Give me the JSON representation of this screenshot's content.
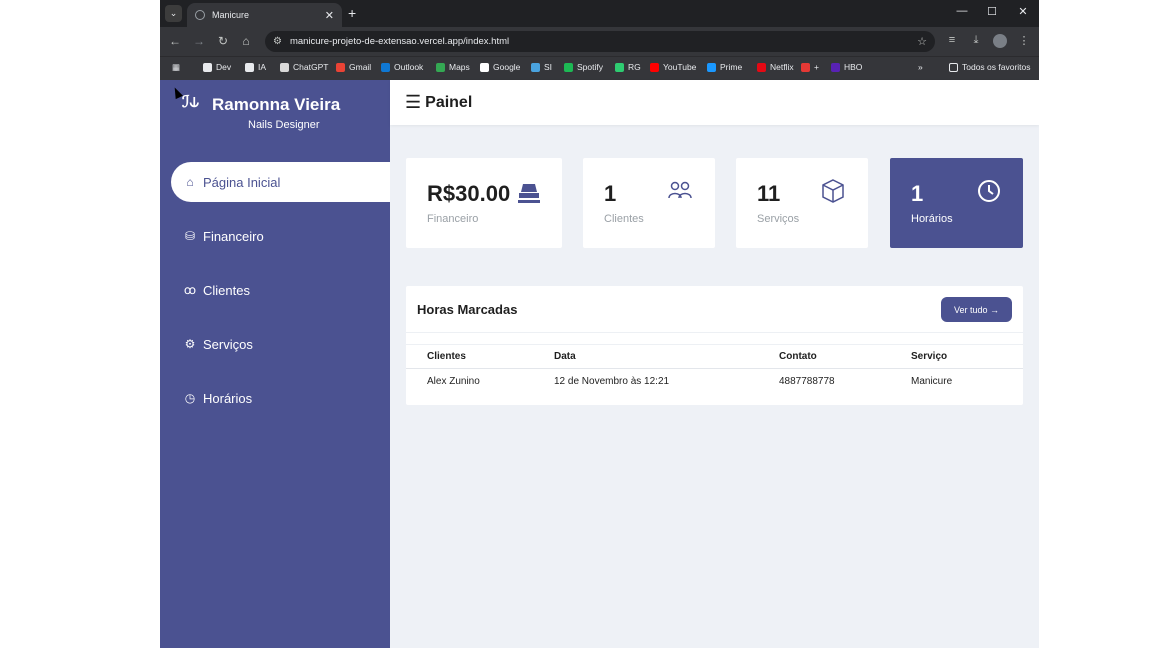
{
  "browser": {
    "tab_title": "Manicure",
    "url": "manicure-projeto-de-extensao.vercel.app/index.html",
    "bookmarks": [
      {
        "label": "Dev",
        "color": "#e8eaed"
      },
      {
        "label": "IA",
        "color": "#e8eaed"
      },
      {
        "label": "ChatGPT",
        "color": "#d9d9d9"
      },
      {
        "label": "Gmail",
        "color": "#ea4335"
      },
      {
        "label": "Outlook",
        "color": "#0f78d4"
      },
      {
        "label": "Maps",
        "color": "#34a853"
      },
      {
        "label": "Google",
        "color": "#ffffff"
      },
      {
        "label": "SI",
        "color": "#4aa3df"
      },
      {
        "label": "Spotify",
        "color": "#1db954"
      },
      {
        "label": "RG",
        "color": "#2ecc71"
      },
      {
        "label": "YouTube",
        "color": "#ff0000"
      },
      {
        "label": "Prime",
        "color": "#1a98ff"
      },
      {
        "label": "Netflix",
        "color": "#e50914"
      },
      {
        "label": "+",
        "color": "#e53935"
      },
      {
        "label": "HBO",
        "color": "#5822b4"
      }
    ],
    "all_bookmarks": "Todos os favoritos"
  },
  "sidebar": {
    "name": "Ramonna Vieira",
    "subtitle": "Nails Designer",
    "items": [
      {
        "label": "Página Inicial",
        "icon": "home-icon"
      },
      {
        "label": "Financeiro",
        "icon": "cash-icon"
      },
      {
        "label": "Clientes",
        "icon": "users-icon"
      },
      {
        "label": "Serviços",
        "icon": "gears-icon"
      },
      {
        "label": "Horários",
        "icon": "clock-icon"
      }
    ]
  },
  "header": {
    "title": "Painel"
  },
  "cards": [
    {
      "value": "R$30.00",
      "label": "Financeiro",
      "icon": "cash-icon"
    },
    {
      "value": "1",
      "label": "Clientes",
      "icon": "users-icon"
    },
    {
      "value": "11",
      "label": "Serviços",
      "icon": "box-icon"
    },
    {
      "value": "1",
      "label": "Horários",
      "icon": "clock-icon"
    }
  ],
  "recent": {
    "title": "Horas Marcadas",
    "button": "Ver tudo →",
    "columns": [
      "Clientes",
      "Data",
      "Contato",
      "Serviço"
    ],
    "rows": [
      [
        "Alex Zunino",
        "12 de Novembro às 12:21",
        "4887788778",
        "Manicure"
      ]
    ]
  },
  "colors": {
    "primary": "#4b5291",
    "background": "#eef1f6"
  }
}
